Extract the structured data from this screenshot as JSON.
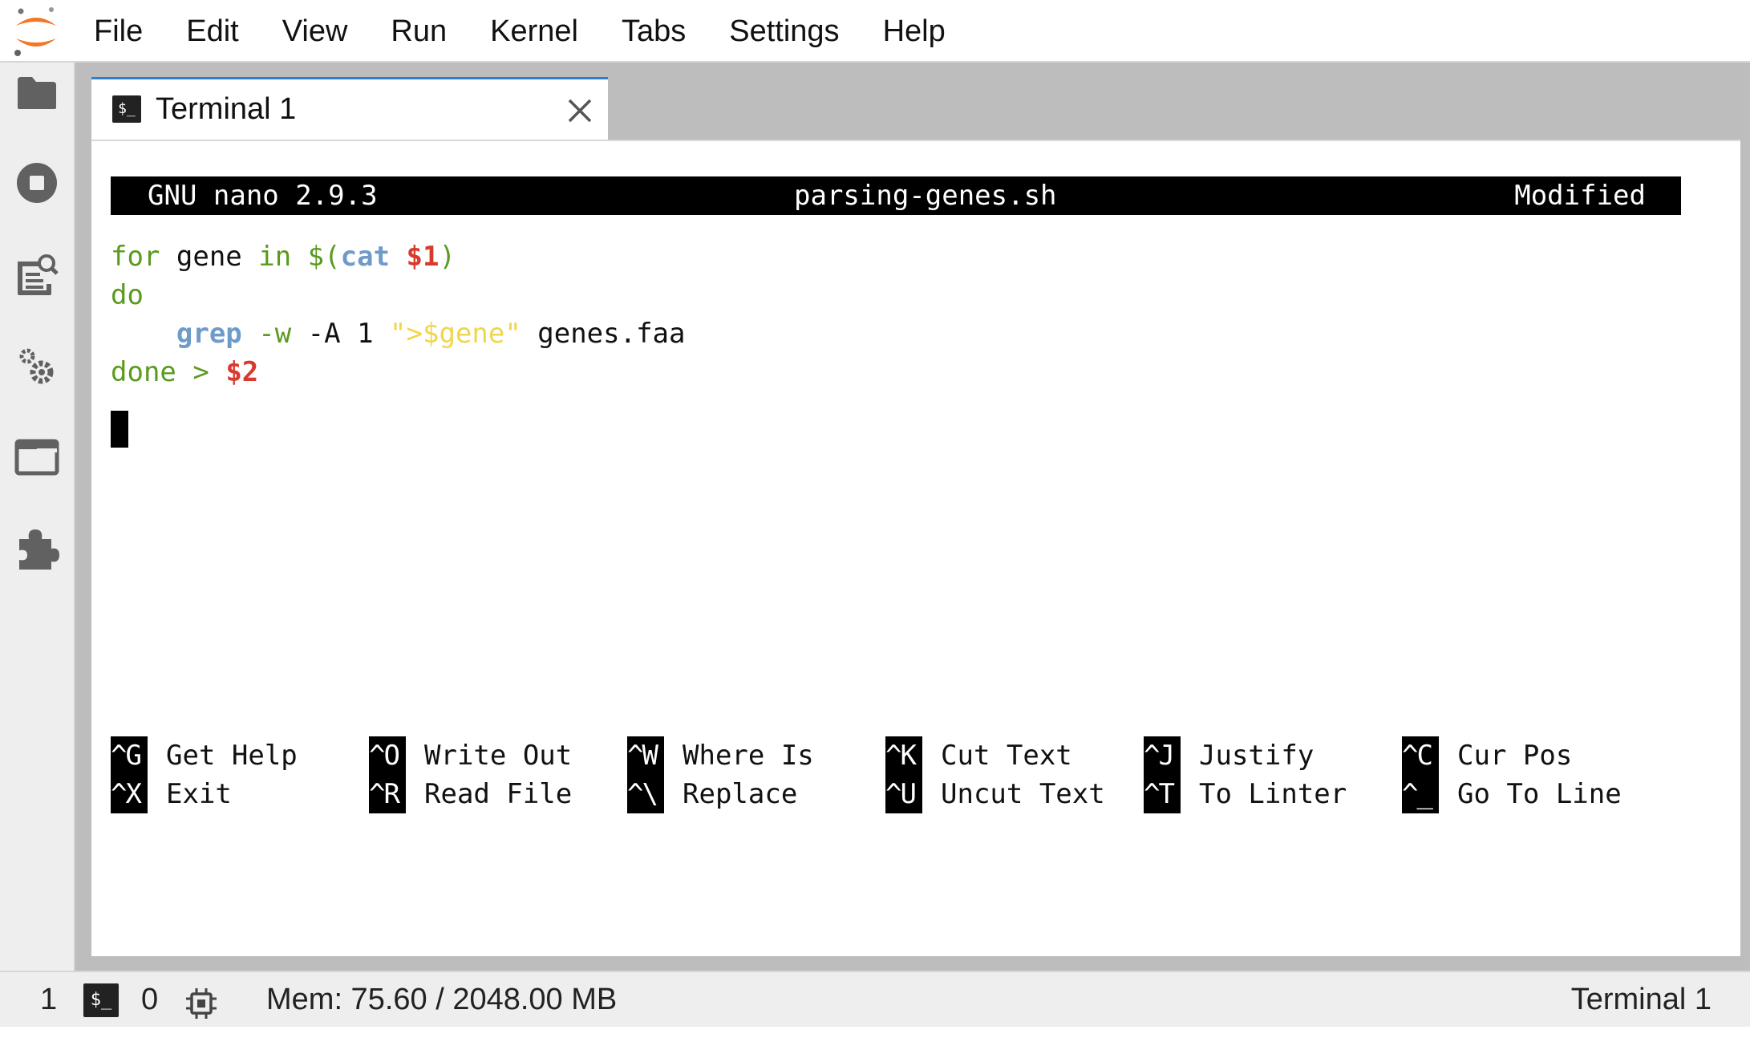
{
  "menubar": {
    "logo_icon": "jupyter-logo-icon",
    "items": [
      "File",
      "Edit",
      "View",
      "Run",
      "Kernel",
      "Tabs",
      "Settings",
      "Help"
    ]
  },
  "sidebar": {
    "icons": [
      "folder-icon",
      "stop-circle-icon",
      "property-inspector-icon",
      "gears-icon",
      "tabs-icon",
      "extension-puzzle-icon"
    ]
  },
  "tab": {
    "icon": "terminal-icon",
    "icon_text": "$_",
    "label": "Terminal 1",
    "close_icon": "close-icon"
  },
  "nano": {
    "version": "GNU nano 2.9.3",
    "filename": "parsing-genes.sh",
    "status": "Modified",
    "code": {
      "line1": {
        "kw_for": "for",
        "var": " gene ",
        "kw_in": "in",
        "dollar_paren": " $(",
        "cmd_cat": "cat",
        "sp": " ",
        "arg1": "$1",
        "close": ")"
      },
      "line2": {
        "kw_do": "do"
      },
      "line3": {
        "indent": "    ",
        "cmd_grep": "grep",
        "flag_w": " -w ",
        "rest": "-A 1 ",
        "string": "\">$gene\"",
        "file": " genes.faa"
      },
      "line4": {
        "kw_done": "done",
        "redirect": " > ",
        "arg2": "$2"
      }
    },
    "shortcuts": [
      {
        "key": "^G",
        "label": "Get Help"
      },
      {
        "key": "^O",
        "label": "Write Out"
      },
      {
        "key": "^W",
        "label": "Where Is"
      },
      {
        "key": "^K",
        "label": "Cut Text"
      },
      {
        "key": "^J",
        "label": "Justify"
      },
      {
        "key": "^C",
        "label": "Cur Pos"
      },
      {
        "key": "^X",
        "label": "Exit"
      },
      {
        "key": "^R",
        "label": "Read File"
      },
      {
        "key": "^\\",
        "label": "Replace"
      },
      {
        "key": "^U",
        "label": "Uncut Text"
      },
      {
        "key": "^T",
        "label": "To Linter"
      },
      {
        "key": "^_",
        "label": "Go To Line"
      }
    ]
  },
  "statusbar": {
    "kernel_count": "1",
    "terminal_icon_text": "$_",
    "terminal_count": "0",
    "memory_icon": "cpu-chip-icon",
    "memory": "Mem: 75.60 / 2048.00 MB",
    "active_item": "Terminal 1"
  }
}
